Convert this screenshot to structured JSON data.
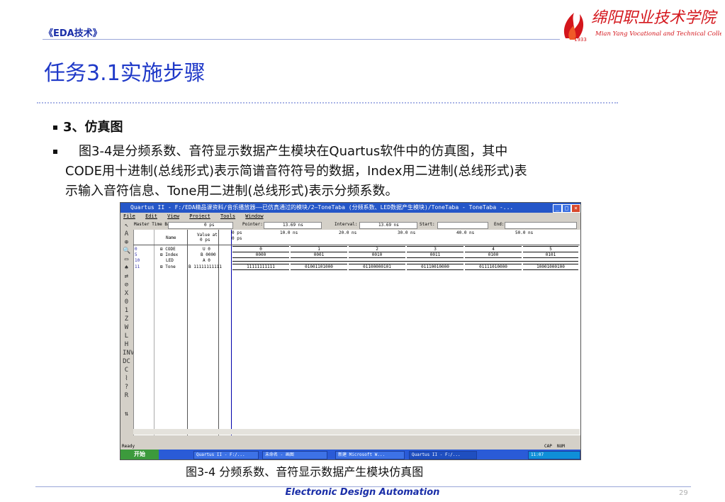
{
  "header": {
    "course": "《EDA技术》",
    "title": "任务3.1实施步骤",
    "logo_text": "绵阳职业技术学院",
    "logo_subtitle": "Mian Yang Vocational and Technical College",
    "logo_year": "1933"
  },
  "content": {
    "bullet1": "3、仿真图",
    "bullet2_lines": [
      "图3-4是分频系数、音符显示数据产生模块在Quartus软件中的仿真图，其中",
      "CODE用十进制(总线形式)表示简谱音符符号的数据，Index用二进制(总线形式)表",
      "示输入音符信息、Tone用二进制(总线形式)表示分频系数。"
    ]
  },
  "screenshot": {
    "window_title": "Quartus II - F:/EDA精品课资料/音乐播放器——已仿真通过的模块/2—ToneTaba (分频系数、LED数据产生模块)/ToneTaba - ToneTaba -...",
    "menu": [
      "File",
      "Edit",
      "View",
      "Project",
      "Tools",
      "Window"
    ],
    "toolbar": {
      "master_label": "Master Time Bar:",
      "master_value": "0 ps",
      "pointer_label": "Pointer:",
      "pointer_value": "13.69 ns",
      "interval_label": "Interval:",
      "interval_value": "13.69 ns",
      "start_label": "Start:",
      "end_label": "End:"
    },
    "columns": {
      "name": "Name",
      "value": "Value at",
      "value_sub": "0 ps"
    },
    "time_ticks": [
      "0 ps",
      "10.0 ns",
      "20.0 ns",
      "30.0 ns",
      "40.0 ns",
      "50.0 ns"
    ],
    "cursor_label": "0 ps",
    "signals": [
      {
        "id": "0",
        "name": "CODE",
        "value": "U 0",
        "waves": [
          "0",
          "1",
          "2",
          "3",
          "4",
          "5"
        ]
      },
      {
        "id": "5",
        "name": "Index",
        "value": "B 0000",
        "waves": [
          "0000",
          "0001",
          "0010",
          "0011",
          "0100",
          "0101"
        ]
      },
      {
        "id": "10",
        "name": "LED",
        "value": "A 0",
        "waves": []
      },
      {
        "id": "11",
        "name": "Tone",
        "value": "B 11111111111",
        "waves": [
          "11111111111",
          "01001101000",
          "01100000101",
          "01110010000",
          "01111010000",
          "10001000100"
        ]
      }
    ],
    "status_ready": "Ready",
    "status_caps": "CAP",
    "status_num": "NUM",
    "taskbar": {
      "start": "开始",
      "items": [
        "Quartus II - F:/...",
        "未命名 - 画图",
        "新建 Microsoft W...",
        "Quartus II - F:/..."
      ],
      "clock": "11:07"
    }
  },
  "caption": "图3-4   分频系数、音符显示数据产生模块仿真图",
  "footer": {
    "text": "Electronic Design Automation",
    "page": "29"
  },
  "colors": {
    "accent": "#1f39c8",
    "logo": "#d4161c"
  }
}
